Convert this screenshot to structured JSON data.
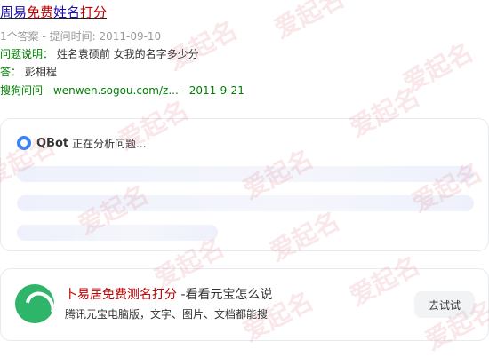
{
  "result": {
    "title_part1": "周易",
    "title_part2": "免费",
    "title_part3": "姓名",
    "title_part4": "打分",
    "meta": "1个答案 - 提问时间: 2011-09-10",
    "question_label": "问题说明：",
    "question_text": "姓名袁硕前 女我的名字多少分",
    "answer_label": "答：",
    "answer_text": "彭相程",
    "source": "搜狗问问 - wenwen.sogou.com/z... - 2011-9-21"
  },
  "qbot": {
    "name": "QBot",
    "status": "正在分析问题..."
  },
  "promo": {
    "title_main": "卜易居免费测名打分",
    "title_suffix": " -看看元宝怎么说",
    "description": "腾讯元宝电脑版，文字、图片、文档都能搜",
    "button_label": "去试试"
  },
  "watermark": {
    "text": "爱起名"
  }
}
